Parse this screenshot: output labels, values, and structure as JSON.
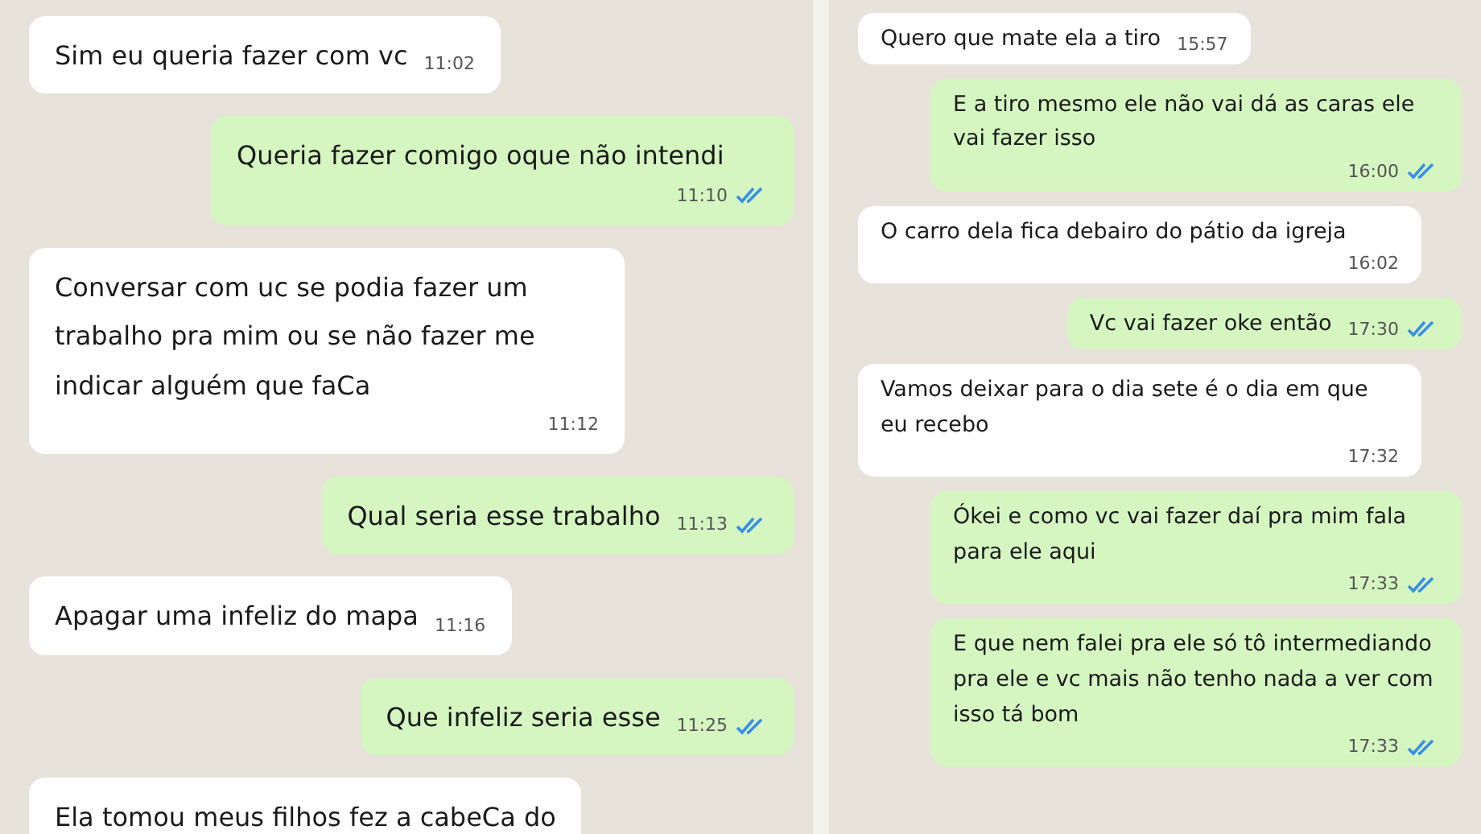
{
  "panels": [
    {
      "messages": [
        {
          "kind": "received",
          "text": "Sim eu queria fazer com vc",
          "time": "11:02"
        },
        {
          "kind": "sent",
          "text": "Queria fazer comigo oque não intendi",
          "time": "11:10",
          "read": true
        },
        {
          "kind": "received",
          "text": "Conversar com uc se podia fazer um trabalho pra mim ou se não fazer me indicar alguém que faCa",
          "time": "11:12"
        },
        {
          "kind": "sent",
          "text": "Qual seria esse trabalho",
          "time": "11:13",
          "read": true
        },
        {
          "kind": "received",
          "text": "Apagar uma infeliz do mapa",
          "time": "11:16"
        },
        {
          "kind": "sent",
          "text": "Que infeliz seria esse",
          "time": "11:25",
          "read": true
        },
        {
          "kind": "received",
          "text": "Ela tomou meus filhos fez a cabeCa do"
        }
      ]
    },
    {
      "messages": [
        {
          "kind": "received",
          "text": "Quero que mate ela a tiro",
          "time": "15:57"
        },
        {
          "kind": "sent",
          "text": "E a tiro mesmo ele não vai dá as caras ele vai fazer isso",
          "time": "16:00",
          "read": true
        },
        {
          "kind": "received",
          "text": "O carro dela fica debairo do pátio da igreja",
          "time": "16:02"
        },
        {
          "kind": "sent",
          "text": "Vc vai fazer oke então",
          "time": "17:30",
          "read": true
        },
        {
          "kind": "received",
          "text": "Vamos deixar para o dia sete é o dia em que eu recebo",
          "time": "17:32"
        },
        {
          "kind": "sent",
          "text": "Ókei e como vc vai fazer daí pra mim fala para ele aqui",
          "time": "17:33",
          "read": true
        },
        {
          "kind": "sent",
          "text": "E que nem falei pra ele só tô intermediando pra ele e vc mais não tenho nada a ver com isso tá bom",
          "time": "17:33",
          "read": true
        }
      ]
    }
  ]
}
